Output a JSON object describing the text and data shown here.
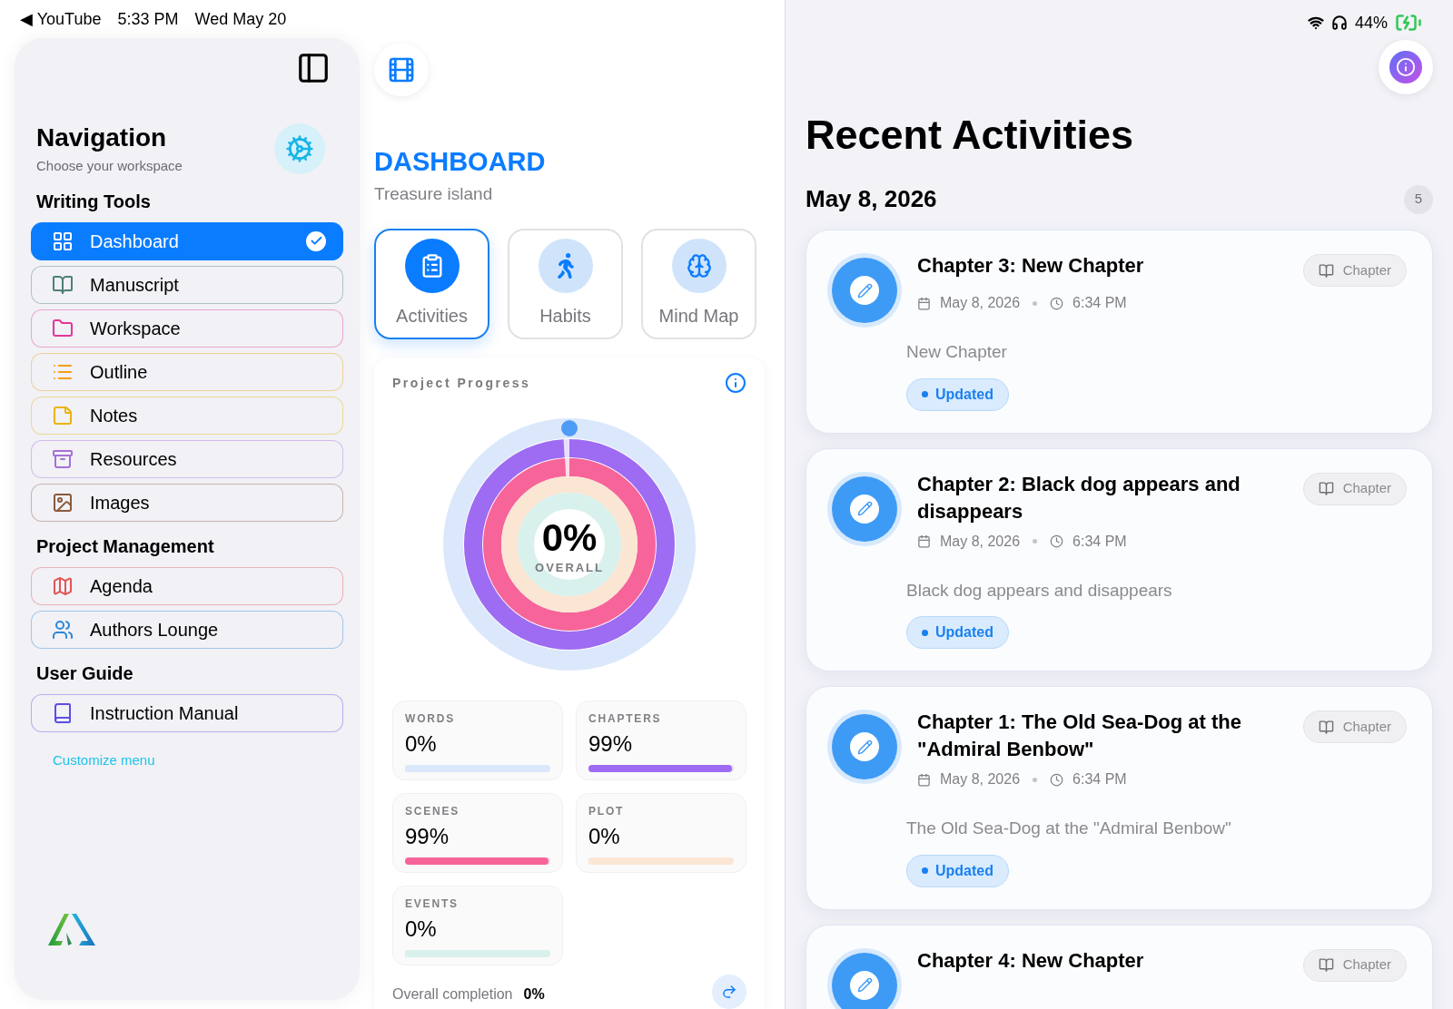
{
  "status_bar": {
    "left": [
      "◀ YouTube",
      "5:33 PM",
      "Wed May 20"
    ],
    "battery": "44%"
  },
  "sidebar": {
    "title": "Navigation",
    "subtitle": "Choose your workspace",
    "sections": [
      {
        "heading": "Writing Tools",
        "items": [
          {
            "label": "Dashboard",
            "color": "#0a7cff",
            "selected": true
          },
          {
            "label": "Manuscript",
            "color": "#4f7f7a",
            "selected": false
          },
          {
            "label": "Workspace",
            "color": "#e5359b",
            "selected": false
          },
          {
            "label": "Outline",
            "color": "#f59e0b",
            "selected": false
          },
          {
            "label": "Notes",
            "color": "#eab308",
            "selected": false
          },
          {
            "label": "Resources",
            "color": "#a66fd6",
            "selected": false
          },
          {
            "label": "Images",
            "color": "#8b5a3c",
            "selected": false
          }
        ]
      },
      {
        "heading": "Project Management",
        "items": [
          {
            "label": "Agenda",
            "color": "#e25555",
            "selected": false
          },
          {
            "label": "Authors Lounge",
            "color": "#2f86d6",
            "selected": false
          }
        ]
      },
      {
        "heading": "User Guide",
        "items": [
          {
            "label": "Instruction Manual",
            "color": "#5b4ee6",
            "selected": false
          }
        ]
      }
    ],
    "customize_link": "Customize menu"
  },
  "dashboard": {
    "title": "DASHBOARD",
    "subtitle": "Treasure island",
    "tabs": [
      {
        "label": "Activities",
        "selected": true
      },
      {
        "label": "Habits",
        "selected": false
      },
      {
        "label": "Mind Map",
        "selected": false
      }
    ],
    "progress": {
      "title": "Project Progress",
      "overall_value": "0%",
      "overall_label": "OVERALL",
      "stats": [
        {
          "label": "WORDS",
          "value": "0%",
          "level": 0,
          "color": "#dbe8fb"
        },
        {
          "label": "CHAPTERS",
          "value": "99%",
          "level": 0.99,
          "color": "#9d6cf2"
        },
        {
          "label": "SCENES",
          "value": "99%",
          "level": 0.99,
          "color": "#f7649a"
        },
        {
          "label": "PLOT",
          "value": "0%",
          "level": 0,
          "color": "#fbe6d4"
        },
        {
          "label": "EVENTS",
          "value": "0%",
          "level": 0,
          "color": "#d8f1ec"
        }
      ],
      "footer_label": "Overall completion",
      "footer_value": "0%"
    }
  },
  "activities": {
    "title": "Recent Activities",
    "groups": [
      {
        "date": "May 8, 2026",
        "count": "5",
        "items": [
          {
            "title": "Chapter 3: New Chapter",
            "date": "May 8, 2026",
            "time": "6:34 PM",
            "description": "New Chapter",
            "status": "Updated",
            "tag": "Chapter"
          },
          {
            "title": "Chapter 2: Black dog appears and disappears",
            "date": "May 8, 2026",
            "time": "6:34 PM",
            "description": "Black dog appears and disappears",
            "status": "Updated",
            "tag": "Chapter"
          },
          {
            "title": "Chapter 1: The Old Sea-Dog at the \"Admiral Benbow\"",
            "date": "May 8, 2026",
            "time": "6:34 PM",
            "description": "The Old Sea-Dog at the \"Admiral Benbow\"",
            "status": "Updated",
            "tag": "Chapter"
          },
          {
            "title": "Chapter 4: New Chapter",
            "tag": "Chapter"
          }
        ]
      }
    ]
  }
}
